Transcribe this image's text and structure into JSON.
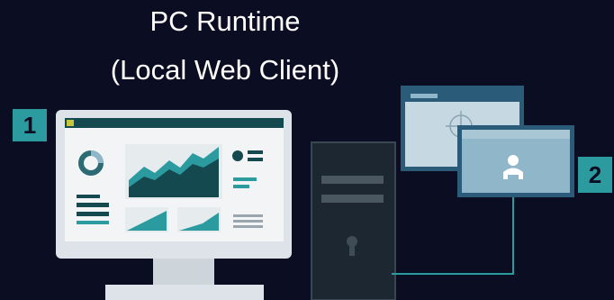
{
  "title": {
    "line1": "PC Runtime",
    "line2": "(Local Web Client)"
  },
  "badges": {
    "monitor_badge": "1",
    "client_badge": "2"
  },
  "colors": {
    "background": "#0b0d22",
    "badge": "#2c9b9f",
    "monitor_frame": "#dde3e8",
    "screen_bg": "#f2f4f6",
    "dark_teal": "#14494f",
    "teal": "#2c9b9f",
    "window_blue": "#8fb6c9",
    "tower_dark": "#1d2731",
    "connector": "#2c9b9f"
  },
  "icons": {
    "monitor": "dashboard-monitor-icon",
    "tower": "pc-tower-icon",
    "scada_window": "target-window-icon",
    "user_window": "user-window-icon"
  }
}
